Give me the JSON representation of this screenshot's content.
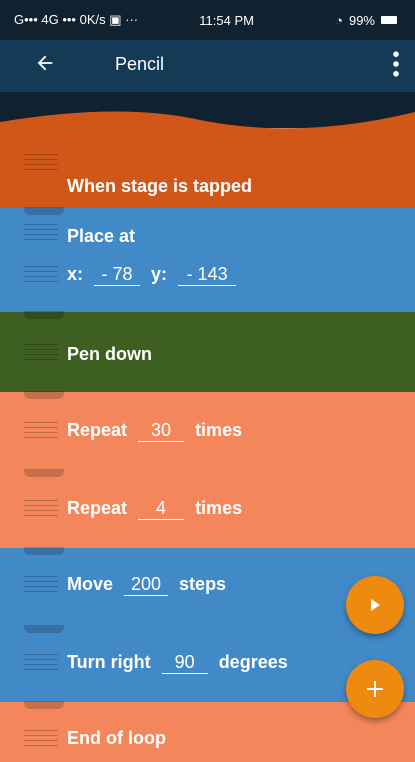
{
  "status": {
    "left": "G••• 4G •••  0K/s ▣ ···",
    "time": "11:54 PM",
    "battery": "99%"
  },
  "appbar": {
    "title": "Pencil"
  },
  "colors": {
    "orange_dark": "#d05718",
    "blue": "#4289c8",
    "green": "#3e5f22",
    "orange_light": "#f3875b",
    "fab": "#ef8a10"
  },
  "blocks": {
    "when_tapped": "When stage is tapped",
    "place_at": {
      "label": "Place at",
      "x_label": "x:",
      "x_value": "- 78",
      "y_label": "y:",
      "y_value": "- 143"
    },
    "pen_down": "Pen down",
    "repeat1": {
      "label": "Repeat",
      "value": "30",
      "suffix": "times"
    },
    "repeat2": {
      "label": "Repeat",
      "value": "4",
      "suffix": "times"
    },
    "move": {
      "label": "Move",
      "value": "200",
      "suffix": "steps"
    },
    "turn": {
      "label": "Turn right",
      "value": "90",
      "suffix": "degrees"
    },
    "end_loop": "End of loop"
  },
  "icons": {
    "back": "arrow-left",
    "menu": "more-vertical",
    "play": "play",
    "add": "plus"
  }
}
